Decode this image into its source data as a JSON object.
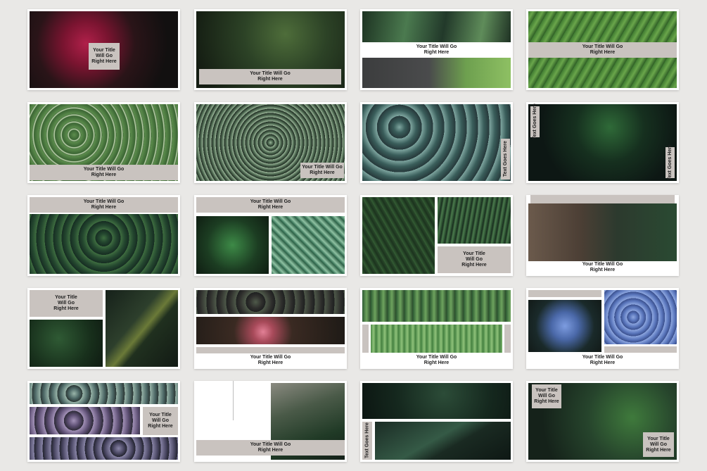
{
  "labels": {
    "title_two_line": "Your Title Will Go\nRight Here",
    "title_three_line": "Your Title\nWill Go\nRight Here",
    "text_goes_here": "Text Goes Here"
  },
  "colors": {
    "background": "#e9e8e6",
    "card": "#ffffff",
    "label_box": "#c9c3bf"
  },
  "thumbnails": [
    {
      "name": "peony-flower",
      "color": "#5a1a2a"
    },
    {
      "name": "shrub-leaves",
      "color": "#24331f"
    },
    {
      "name": "tropical-leaves",
      "color": "#2e4f35"
    },
    {
      "name": "fan-palm",
      "color": "#4f8a3b"
    },
    {
      "name": "fittonia",
      "color": "#3f6a38"
    },
    {
      "name": "pilea-vine",
      "color": "#2a3a2c"
    },
    {
      "name": "succulents",
      "color": "#3b5a58"
    },
    {
      "name": "dark-leaves",
      "color": "#12201a"
    },
    {
      "name": "ivy-wall",
      "color": "#1e3a2c"
    },
    {
      "name": "calathea",
      "color": "#2f5a45"
    },
    {
      "name": "ferns",
      "color": "#1f3522"
    },
    {
      "name": "bark-and-palms",
      "color": "#3e3a33"
    },
    {
      "name": "monstera-bush",
      "color": "#1c2b20"
    },
    {
      "name": "lotus-pond",
      "color": "#3a2a2a"
    },
    {
      "name": "cactus",
      "color": "#4d7a4a"
    },
    {
      "name": "hydrangea",
      "color": "#4a68a8"
    },
    {
      "name": "purple-succulents",
      "color": "#4b4a5e"
    },
    {
      "name": "jungle-trees",
      "color": "#2c3a2e"
    },
    {
      "name": "wet-leaf",
      "color": "#1b2c25"
    },
    {
      "name": "monstera-leaf",
      "color": "#26442c"
    }
  ]
}
